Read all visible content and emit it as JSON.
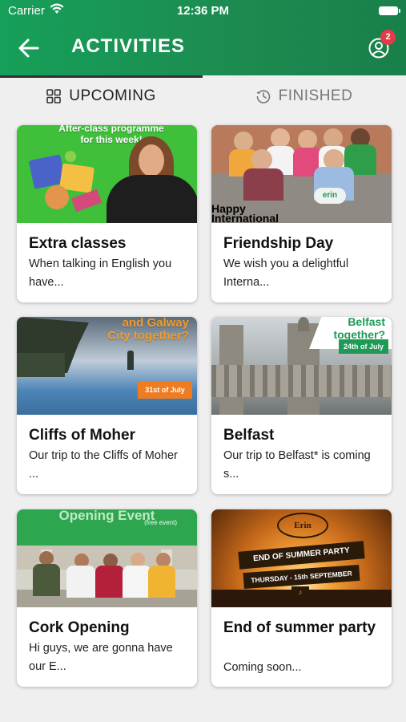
{
  "status_bar": {
    "carrier": "Carrier",
    "time": "12:36 PM"
  },
  "header": {
    "title": "ACTIVITIES",
    "notification_count": "2",
    "color": "#1d9a56"
  },
  "tabs": [
    {
      "label": "UPCOMING",
      "icon": "grid-icon",
      "selected": true
    },
    {
      "label": "FINISHED",
      "icon": "history-icon",
      "selected": false
    }
  ],
  "cards": [
    {
      "title": "Extra classes",
      "desc": "When talking in English you have...",
      "banner": "After-class programme for this week!"
    },
    {
      "title": "Friendship Day",
      "desc": "We wish you a delightful Interna...",
      "banner": "Happy International"
    },
    {
      "title": "Cliffs of Moher",
      "desc": "Our trip to the Cliffs of Moher ...",
      "banner": "and Galway City together?",
      "badge": "31st of July"
    },
    {
      "title": "Belfast",
      "desc": "Our trip to Belfast* is coming s...",
      "banner": "Belfast together?",
      "badge": "24th of July"
    },
    {
      "title": "Cork Opening",
      "desc": "Hi guys, we are gonna have our E...",
      "banner": "Opening Event",
      "sub": "(free event)"
    },
    {
      "title": "End of summer party",
      "desc": "Coming soon...",
      "banner": "END OF SUMMER PARTY",
      "sub": "THURSDAY - 15th SEPTEMBER"
    }
  ]
}
